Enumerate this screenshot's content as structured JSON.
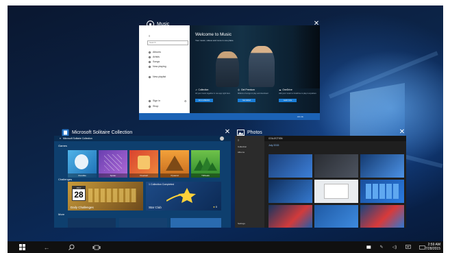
{
  "windows": {
    "music": {
      "title": "Music",
      "sidebar": {
        "search_placeholder": "Search",
        "items": [
          "Albums",
          "Artists",
          "Songs",
          "Now playing",
          "New playlist"
        ],
        "footer": [
          "Sign in",
          "Shop"
        ]
      },
      "hero": {
        "heading": "Welcome to Music",
        "subheading": "Your music, videos and more in one place",
        "columns": [
          {
            "label": "Collection",
            "desc": "All your music together in one app right here",
            "button": "Go to collection"
          },
          {
            "label": "Get Premium",
            "desc": "Millions of songs to play and download",
            "button": "Get started"
          },
          {
            "label": "OneDrive",
            "desc": "Add your music to OneDrive to play it anywhere",
            "button": "Learn more"
          }
        ]
      }
    },
    "solitaire": {
      "title": "Microsoft Solitaire Collection",
      "app_bar": "Microsoft Solitaire Collection",
      "sections": {
        "games": "Games",
        "challenges": "Challenges",
        "more": "More"
      },
      "games": [
        "Klondike",
        "Spider",
        "FreeCell",
        "Pyramid",
        "TriPeaks"
      ],
      "daily": {
        "month": "JULY",
        "day": "28",
        "label": "Daily Challenges"
      },
      "star_club": {
        "banner": "1 Collection Completed",
        "label": "Star Club",
        "count": "0"
      }
    },
    "photos": {
      "title": "Photos",
      "header": "COLLECTION",
      "month": "July 2015",
      "nav": [
        "Collection",
        "Albums",
        "Settings"
      ]
    }
  },
  "taskbar": {
    "clock": {
      "time": "2:59 AM",
      "date": "7/28/2015"
    },
    "icons": [
      "windows-icon",
      "back-icon",
      "search-icon",
      "task-view-icon"
    ]
  },
  "colors": {
    "taskbar": "#101010",
    "accent_blue": "#1b62b5",
    "solitaire_bg": "#0e3f6e"
  }
}
